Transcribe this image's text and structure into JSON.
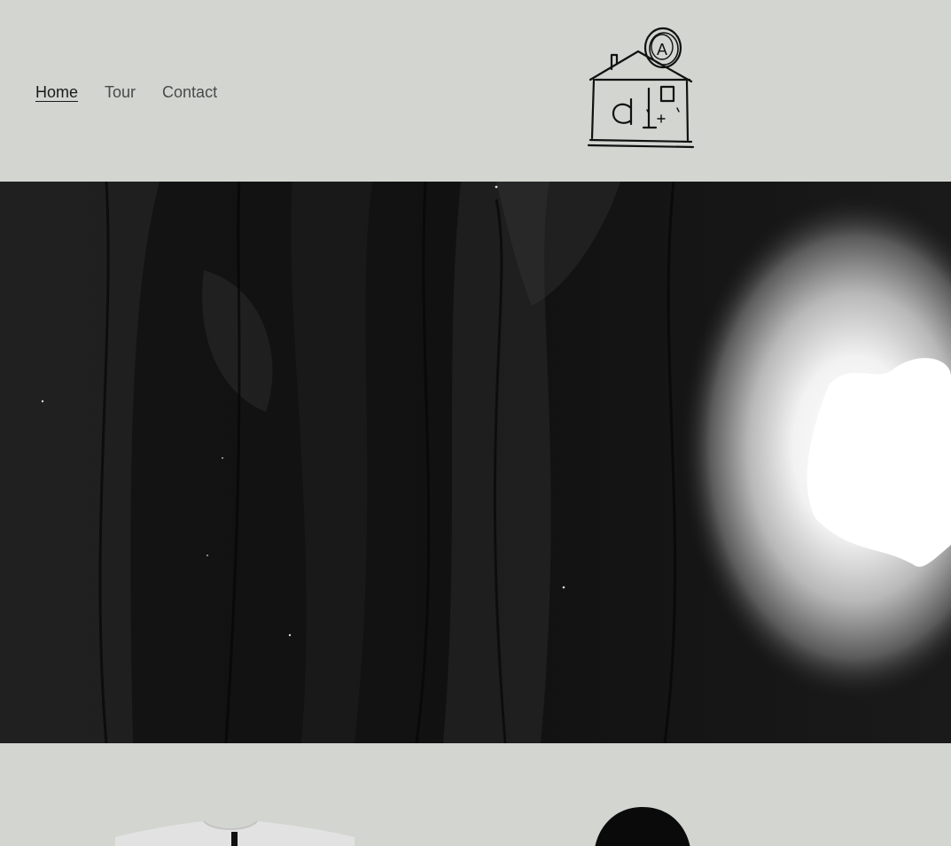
{
  "nav": {
    "items": [
      {
        "label": "Home",
        "active": true
      },
      {
        "label": "Tour",
        "active": false
      },
      {
        "label": "Contact",
        "active": false
      }
    ]
  },
  "logo": {
    "icon": "house-logo-icon",
    "glyphs": {
      "roof_letter": "A",
      "door_letter": "d"
    }
  },
  "hero": {
    "icon": "moon-forest-artwork"
  },
  "products": [
    {
      "icon": "tshirt-icon",
      "color": "#e2e2e2"
    },
    {
      "icon": "hoodie-icon",
      "color": "#0a0a0a"
    }
  ],
  "colors": {
    "background": "#d3d5d0",
    "text": "#4a4a4a",
    "active_text": "#1a1a1a",
    "hero_dark": "#0c0c0c",
    "moon": "#ffffff"
  }
}
